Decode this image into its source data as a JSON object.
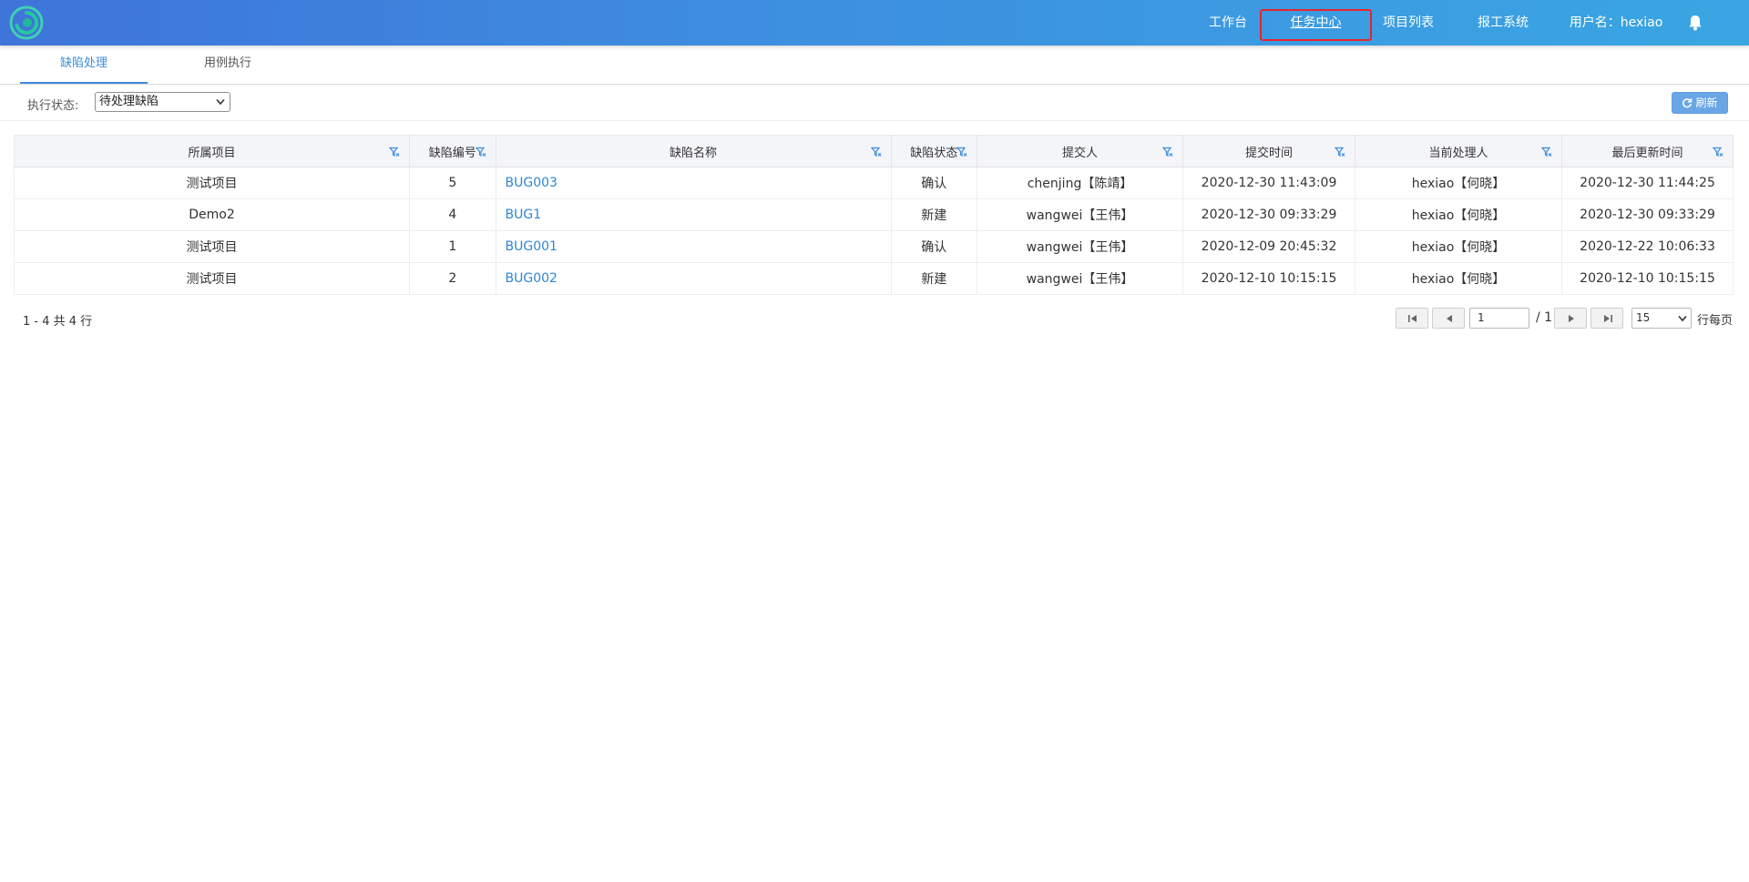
{
  "header": {
    "nav": [
      {
        "label": "工作台"
      },
      {
        "label": "任务中心"
      },
      {
        "label": "项目列表"
      },
      {
        "label": "报工系统"
      }
    ],
    "user_label": "用户名：hexiao"
  },
  "tabs": [
    {
      "label": "缺陷处理"
    },
    {
      "label": "用例执行"
    }
  ],
  "filter": {
    "label": "执行状态:",
    "selected": "待处理缺陷"
  },
  "refresh_label": "刷新",
  "table": {
    "columns": [
      "所属项目",
      "缺陷编号",
      "缺陷名称",
      "缺陷状态",
      "提交人",
      "提交时间",
      "当前处理人",
      "最后更新时间"
    ],
    "rows": [
      {
        "project": "测试项目",
        "id": "5",
        "name": "BUG003",
        "status": "确认",
        "submitter": "chenjing【陈靖】",
        "submitted": "2020-12-30 11:43:09",
        "handler": "hexiao【何晓】",
        "updated": "2020-12-30 11:44:25"
      },
      {
        "project": "Demo2",
        "id": "4",
        "name": "BUG1",
        "status": "新建",
        "submitter": "wangwei【王伟】",
        "submitted": "2020-12-30 09:33:29",
        "handler": "hexiao【何晓】",
        "updated": "2020-12-30 09:33:29"
      },
      {
        "project": "测试项目",
        "id": "1",
        "name": "BUG001",
        "status": "确认",
        "submitter": "wangwei【王伟】",
        "submitted": "2020-12-09 20:45:32",
        "handler": "hexiao【何晓】",
        "updated": "2020-12-22 10:06:33"
      },
      {
        "project": "测试项目",
        "id": "2",
        "name": "BUG002",
        "status": "新建",
        "submitter": "wangwei【王伟】",
        "submitted": "2020-12-10 10:15:15",
        "handler": "hexiao【何晓】",
        "updated": "2020-12-10 10:15:15"
      }
    ]
  },
  "pagination": {
    "summary": "1 - 4 共 4 行",
    "current_page": "1",
    "total_pages": "/ 1",
    "page_size": "15",
    "per_page_label": "行每页"
  }
}
